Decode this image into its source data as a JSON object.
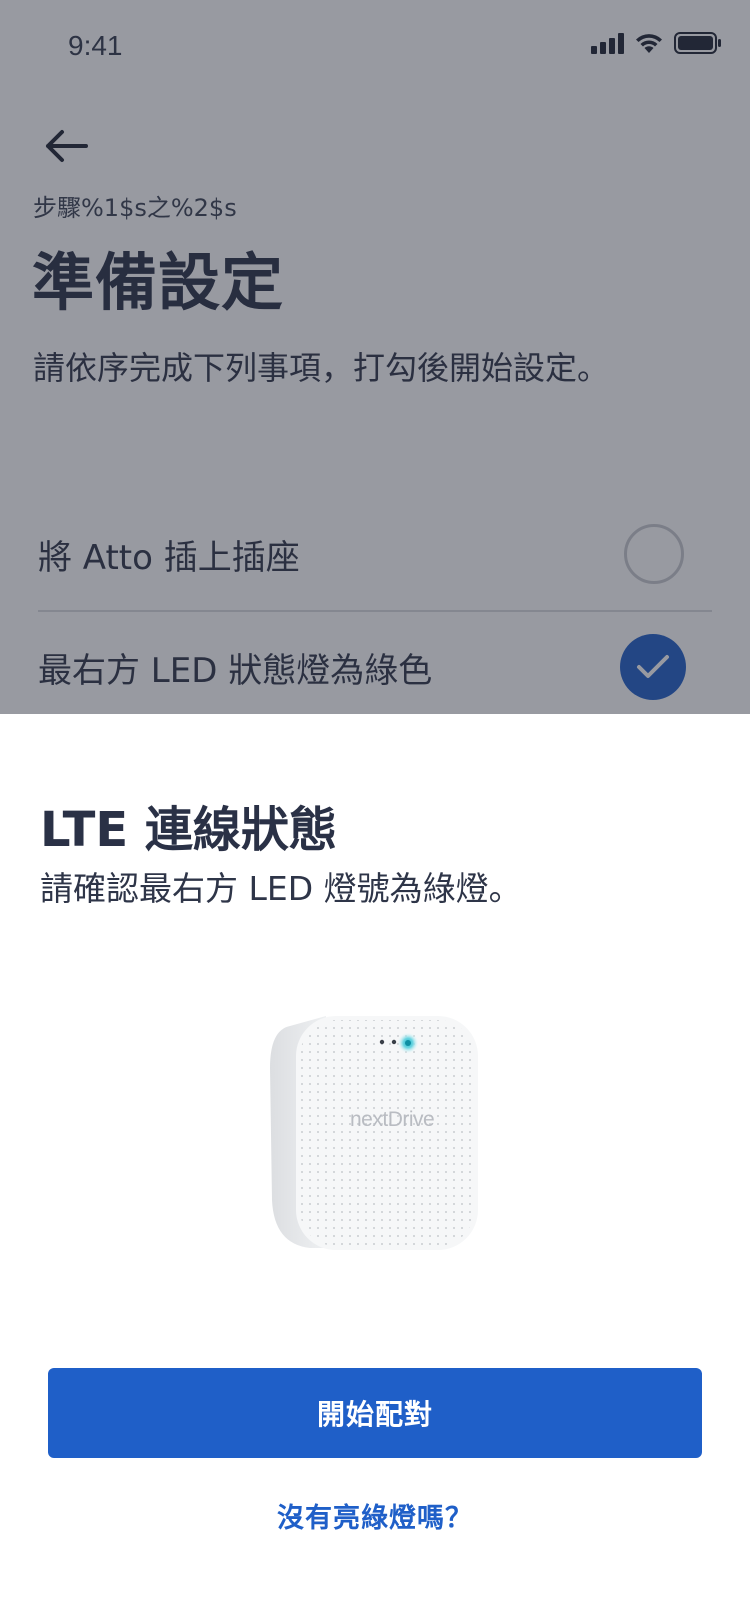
{
  "status_bar": {
    "time": "9:41"
  },
  "page": {
    "step_label": "步驟%1$s之%2$s",
    "title": "準備設定",
    "description": "請依序完成下列事項，打勾後開始設定。",
    "checklist": [
      {
        "label": "將 Atto 插上插座",
        "checked": false
      },
      {
        "label": "最右方 LED 狀態燈為綠色",
        "checked": true
      }
    ]
  },
  "sheet": {
    "title": "LTE 連線狀態",
    "description": "請確認最右方 LED 燈號為綠燈。",
    "device_brand": "nextDrive",
    "primary_button_label": "開始配對",
    "help_link_label": "沒有亮綠燈嗎？"
  },
  "colors": {
    "accent": "#1f5fc8",
    "text_dark": "#2a3146",
    "led": "#3ec7d6"
  }
}
